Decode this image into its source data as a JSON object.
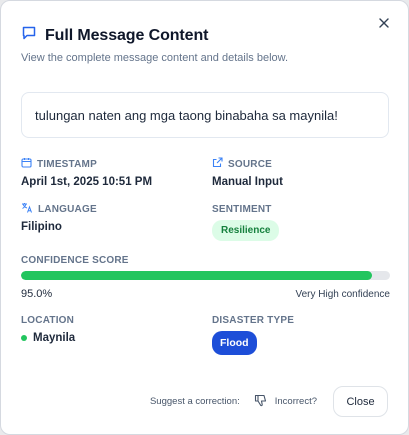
{
  "dialog": {
    "title": "Full Message Content",
    "subtitle": "View the complete message content and details below.",
    "message": "tulungan naten ang mga taong binabaha sa maynila!"
  },
  "fields": {
    "timestamp": {
      "label": "TIMESTAMP",
      "value": "April 1st, 2025 10:51 PM",
      "icon": "calendar-icon"
    },
    "source": {
      "label": "SOURCE",
      "value": "Manual Input",
      "icon": "external-link-icon"
    },
    "language": {
      "label": "LANGUAGE",
      "value": "Filipino",
      "icon": "translate-icon"
    },
    "sentiment": {
      "label": "SENTIMENT",
      "value": "Resilience",
      "color": "#15803d",
      "bg": "#dcfce7"
    },
    "confidence": {
      "label": "CONFIDENCE SCORE",
      "percent_text": "95.0%",
      "level": "Very High confidence",
      "fraction": 0.95,
      "bar_color": "#22c55e"
    },
    "location": {
      "label": "LOCATION",
      "value": "Maynila",
      "icon": "map-pin-icon",
      "dot_color": "#22c55e"
    },
    "disaster": {
      "label": "DISASTER TYPE",
      "value": "Flood",
      "color": "#1d4ed8"
    }
  },
  "footer": {
    "suggest_text": "Suggest a correction:",
    "incorrect_label": "Incorrect?",
    "close_label": "Close"
  }
}
